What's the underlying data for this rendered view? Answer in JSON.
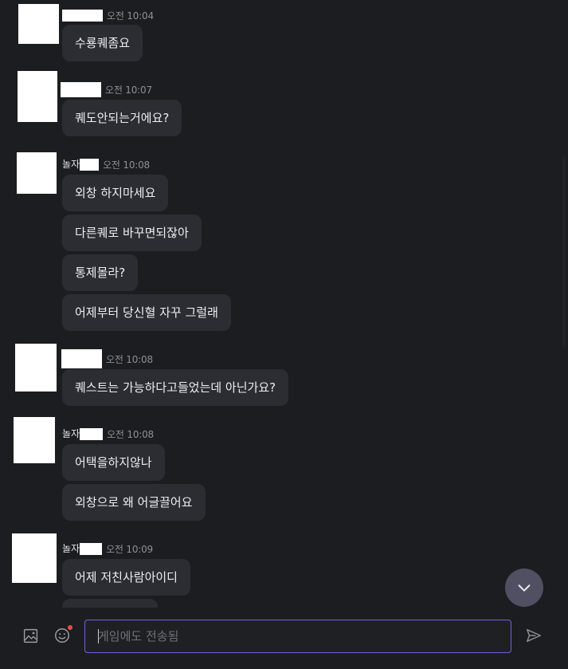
{
  "messages": [
    {
      "group_id": "g1",
      "author_label": "",
      "time": "오전 10:04",
      "bubbles": [
        "수룡퀘좀요"
      ]
    },
    {
      "group_id": "g2",
      "author_label": "",
      "time": "오전 10:07",
      "bubbles": [
        "퀘도안되는거에요?"
      ]
    },
    {
      "group_id": "g3",
      "author_label": "놀자",
      "time": "오전 10:08",
      "bubbles": [
        "외창 하지마세요",
        "다른퀘로 바꾸면되잖아",
        "통제몰라?",
        "어제부터 당신혈 자꾸 그럴래"
      ]
    },
    {
      "group_id": "g4",
      "author_label": "",
      "time": "오전 10:08",
      "bubbles": [
        "퀘스트는 가능하다고들었는데 아닌가요?"
      ]
    },
    {
      "group_id": "g5",
      "author_label": "놀자",
      "time": "오전 10:08",
      "bubbles": [
        "어택을하지않나",
        "외창으로 왜 어글끌어요"
      ]
    },
    {
      "group_id": "g6",
      "author_label": "놀자",
      "time": "오전 10:09",
      "bubbles": [
        "어제 저친사람아이디",
        ""
      ]
    }
  ],
  "input": {
    "placeholder": "게임에도 전송됨",
    "value": ""
  },
  "icons": {
    "image": "image-icon",
    "emoji": "emoji-icon",
    "send": "send-icon",
    "scroll_down": "chevron-down-icon"
  },
  "colors": {
    "background": "#1c1d20",
    "bubble": "#2c2d33",
    "input_border": "#6b65d6",
    "scroll_button": "#4f5061",
    "notification_dot": "#f04a4a"
  }
}
